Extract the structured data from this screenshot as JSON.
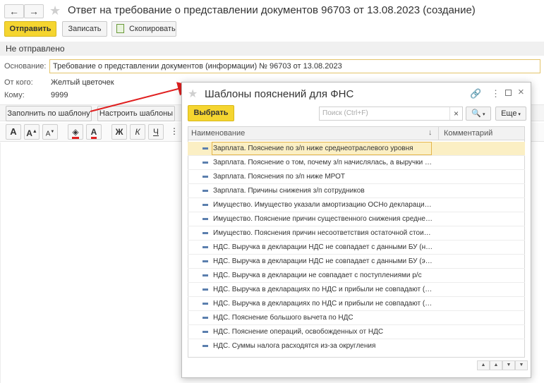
{
  "window": {
    "back_icon": "←",
    "forward_icon": "→",
    "title": "Ответ на требование о представлении документов 96703 от 13.08.2023 (создание)"
  },
  "toolbar": {
    "send_label": "Отправить",
    "save_label": "Записать",
    "copy_label": "Скопировать"
  },
  "status": "Не отправлено",
  "form": {
    "basis_label": "Основание:",
    "basis_value": "Требование о представлении документов (информации) № 96703 от 13.08.2023",
    "from_label": "От кого:",
    "from_value": "Желтый цветочек",
    "to_label": "Кому:",
    "to_value": "9999"
  },
  "actions": {
    "fill_template": "Заполнить по шаблону",
    "setup_templates": "Настроить шаблоны"
  },
  "format_toolbar": {
    "font_bigger": "A",
    "font_increase": "A",
    "font_decrease": "A",
    "bold": "Ж",
    "italic": "К",
    "underline": "Ч",
    "text_color": "A"
  },
  "dialog": {
    "title": "Шаблоны пояснений для ФНС",
    "select_label": "Выбрать",
    "search_placeholder": "Поиск (Ctrl+F)",
    "more_label": "Еще",
    "clear_icon": "×",
    "col_name": "Наименование",
    "col_comment": "Комментарий",
    "sort_icon": "↓",
    "rows": [
      "Зарплата. Пояснение по з/п ниже среднеотраслевого уровня",
      "Зарплата. Пояснение о том, почему з/п начислялась, а выручки нет",
      "Зарплата. Пояснения по з/п ниже МРОТ",
      "Зарплата. Причины снижения з/п сотрудников",
      "Имущество. Имущество указали амортизацию ОСНо декларацию ...",
      "Имущество. Пояснение причин существенного снижения среднего...",
      "Имущество. Пояснения причин несоответствия остаточной стоимо...",
      "НДС. Выручка в декларации НДС не совпадает с данными БУ (не ...",
      "НДС. Выручка в декларации НДС не совпадает с данными БУ (экс...",
      "НДС. Выручка в декларации не совпадает с поступлениями р/с",
      "НДС. Выручка в декларациях по НДС и прибыли не совпадают (вн...",
      "НДС. Выручка в декларациях по НДС и прибыли не совпадают (м...",
      "НДС. Пояснение большого вычета по НДС",
      "НДС. Пояснение операций, освобожденных от НДС",
      "НДС. Суммы налога расходятся из-за округления"
    ]
  },
  "colors": {
    "accent_yellow": "#f5d530",
    "selected_row": "#fbefc4",
    "arrow_red": "#e02020"
  }
}
